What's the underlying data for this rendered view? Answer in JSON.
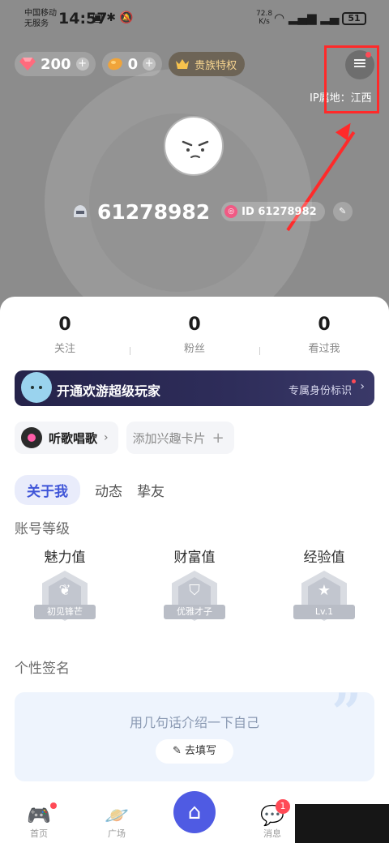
{
  "status_bar": {
    "carrier_line1": "中国移动",
    "carrier_line2": "无服务",
    "time": "14:57",
    "net_speed_value": "72.8",
    "net_speed_unit": "K/s",
    "battery": "51"
  },
  "header": {
    "diamonds": "200",
    "beans": "0",
    "noble_label": "贵族特权",
    "ip_location": "IP属地：江西",
    "username": "61278982",
    "id_badge": "ID 61278982"
  },
  "stats": [
    {
      "value": "0",
      "label": "关注"
    },
    {
      "value": "0",
      "label": "粉丝"
    },
    {
      "value": "0",
      "label": "看过我"
    }
  ],
  "vip_banner": {
    "title": "开通欢游超级玩家",
    "subtitle": "专属身份标识"
  },
  "tags": {
    "song_label": "听歌唱歌",
    "add_label": "添加兴趣卡片"
  },
  "tabs": [
    "关于我",
    "动态",
    "挚友"
  ],
  "account_level": {
    "title": "账号等级",
    "items": [
      {
        "name": "魅力值",
        "badge": "初见锋芒"
      },
      {
        "name": "财富值",
        "badge": "优雅才子"
      },
      {
        "name": "经验值",
        "badge": "Lv.1"
      }
    ]
  },
  "signature": {
    "title": "个性签名",
    "prompt": "用几句话介绍一下自己",
    "button": "去填写"
  },
  "bottom_nav": {
    "home": "首页",
    "plaza": "广场",
    "messages": "消息",
    "message_count": "1"
  },
  "colors": {
    "accent": "#4f5be3",
    "header_grey": "#8c8c8c",
    "annotation_red": "#ff2a2a"
  }
}
